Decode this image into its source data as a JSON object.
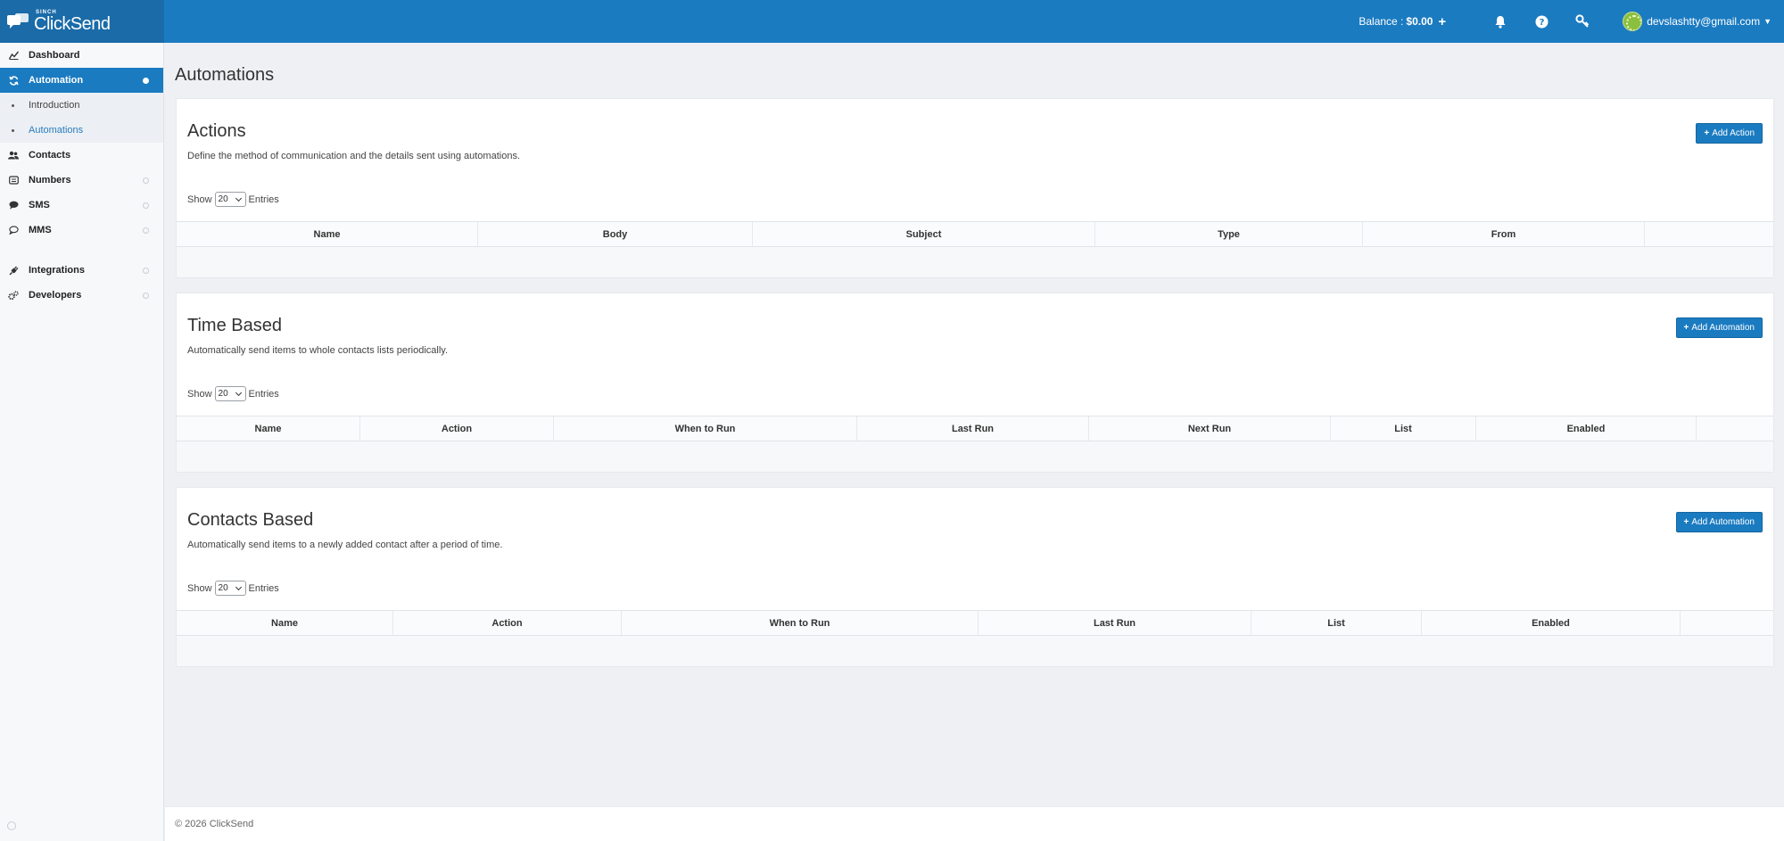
{
  "brand": {
    "sub": "SINCH",
    "name": "ClickSend"
  },
  "header": {
    "balance_label": "Balance : ",
    "balance_value": "$0.00",
    "balance_add": "+",
    "user_email": "devslashtty@gmail.com",
    "icons": [
      "bell-icon",
      "help-icon",
      "key-icon"
    ]
  },
  "sidebar": {
    "items": [
      {
        "label": "Dashboard",
        "icon": "dashboard-icon"
      },
      {
        "label": "Automation",
        "icon": "refresh-icon"
      },
      {
        "label": "Introduction"
      },
      {
        "label": "Automations"
      },
      {
        "label": "Contacts",
        "icon": "users-icon"
      },
      {
        "label": "Numbers",
        "icon": "numbers-icon"
      },
      {
        "label": "SMS",
        "icon": "chat-icon"
      },
      {
        "label": "MMS",
        "icon": "mms-icon"
      },
      {
        "label": "Integrations",
        "icon": "plug-icon"
      },
      {
        "label": "Developers",
        "icon": "cogs-icon"
      }
    ]
  },
  "page": {
    "title": "Automations"
  },
  "sections": {
    "actions": {
      "title": "Actions",
      "description": "Define the method of communication and the details sent using automations.",
      "button": "Add Action",
      "show_label": "Show",
      "entries_value": "20",
      "entries_label": "Entries",
      "columns": [
        "Name",
        "Body",
        "Subject",
        "Type",
        "From",
        ""
      ]
    },
    "time_based": {
      "title": "Time Based",
      "description": "Automatically send items to whole contacts lists periodically.",
      "button": "Add Automation",
      "show_label": "Show",
      "entries_value": "20",
      "entries_label": "Entries",
      "columns": [
        "Name",
        "Action",
        "When to Run",
        "Last Run",
        "Next Run",
        "List",
        "Enabled",
        ""
      ]
    },
    "contacts_based": {
      "title": "Contacts Based",
      "description": "Automatically send items to a newly added contact after a period of time.",
      "button": "Add Automation",
      "show_label": "Show",
      "entries_value": "20",
      "entries_label": "Entries",
      "columns": [
        "Name",
        "Action",
        "When to Run",
        "Last Run",
        "List",
        "Enabled",
        ""
      ]
    }
  },
  "footer": {
    "text": "© 2026 ClickSend"
  },
  "colors": {
    "primary": "#1b7bc1",
    "brand_dark": "#1a6ba8",
    "background": "#eef0f3"
  }
}
